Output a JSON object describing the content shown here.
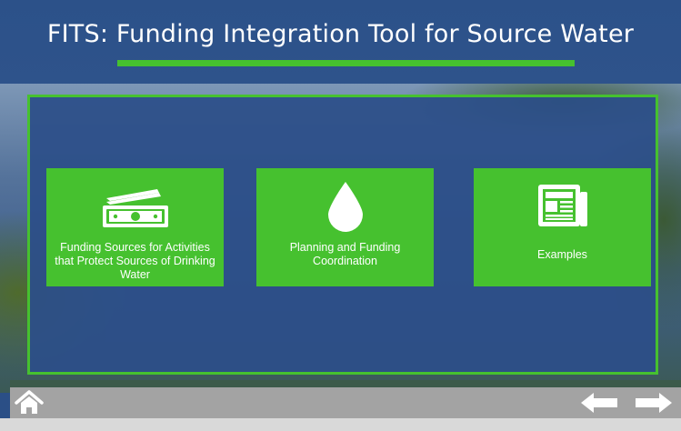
{
  "header": {
    "title": "FITS: Funding Integration Tool for Source Water"
  },
  "tiles": [
    {
      "label": "Funding Sources for Activities that Protect Sources of Drinking Water",
      "icon": "money-icon"
    },
    {
      "label": "Planning and Funding Coordination",
      "icon": "water-drop-icon"
    },
    {
      "label": "Examples",
      "icon": "newspaper-icon"
    }
  ],
  "navigation": {
    "home_icon": "home-icon",
    "prev_icon": "arrow-left-icon",
    "next_icon": "arrow-right-icon"
  },
  "colors": {
    "accent_green": "#46c12f",
    "panel_blue": "#2c4f89",
    "toolbar_gray": "#a3a3a3"
  }
}
